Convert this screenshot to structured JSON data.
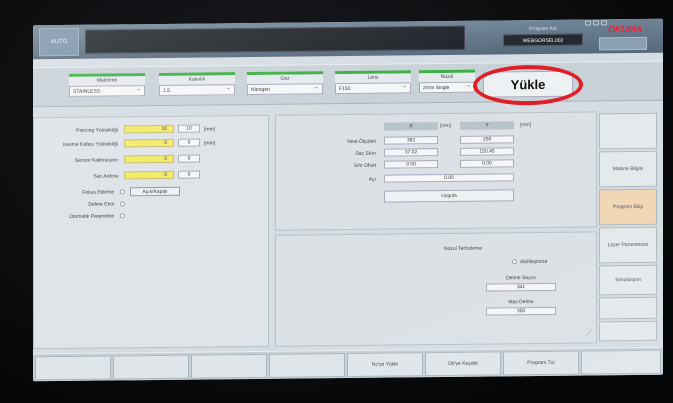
{
  "topbar": {
    "mode_label": "AUTO",
    "program_label": "Program Adı",
    "program_value": "WEBGORSEL002",
    "brand": "OKUMA"
  },
  "config": {
    "fields": [
      {
        "label": "Malzeme",
        "value": "STAINLESS"
      },
      {
        "label": "Kalınlık",
        "value": "1.5"
      },
      {
        "label": "Gaz",
        "value": "Nitrogen"
      },
      {
        "label": "Lens",
        "value": "F150"
      },
      {
        "label": "Nozul",
        "value": "2mm Single"
      }
    ],
    "load_label": "Yükle"
  },
  "left_params": {
    "rows": [
      {
        "label": "Piercing Yüksekliği",
        "main": "16",
        "sub": "10",
        "unit": "[mm]"
      },
      {
        "label": "Kesme Kafası Yüksekliği",
        "main": "0",
        "sub": "0",
        "unit": "[mm]"
      },
      {
        "label": "Sensor Kalibrasyon",
        "main": "0",
        "sub": "0",
        "unit": ""
      },
      {
        "label": "Sac Ardına",
        "main": "0",
        "sub": "0",
        "unit": ""
      }
    ],
    "focus_label": "Fokus Ekleme",
    "focus_button": "Açık/Kapalı",
    "delme_label": "Delme Ekol",
    "otomatik_label": "Otomatik Parametre"
  },
  "upper_panel": {
    "x_head": "X",
    "y_head": "Y",
    "unit_x": "[mm]",
    "unit_y": "[mm]",
    "rows": [
      {
        "label": "Nest Ölçüleri",
        "x": "362",
        "y": "258"
      },
      {
        "label": "Sac Sıfırı",
        "x": "37.02",
        "y": "150.45"
      },
      {
        "label": "Sıfır Ofset",
        "x": "0.00",
        "y": "0.00"
      }
    ],
    "angle_label": "Açı",
    "angle_value": "0.00",
    "apply_label": "Uygula"
  },
  "lower_panel": {
    "title": "Nozul Temizleme",
    "radio_label": "Aktifleştirme",
    "count_label": "Delme Sayısı",
    "count_value": "341",
    "max_label": "Max Delme",
    "max_value": "350"
  },
  "side_menu": {
    "items": [
      "",
      "Makine Bilgisi",
      "Program Bilgi",
      "Lazer Parametresi",
      "Simulasyon",
      "",
      ""
    ]
  },
  "bottom_bar": {
    "keys": [
      "",
      "",
      "",
      "",
      "Nc'ye Yükle",
      "Db'ye Kaydet",
      "Program Tut",
      ""
    ]
  }
}
